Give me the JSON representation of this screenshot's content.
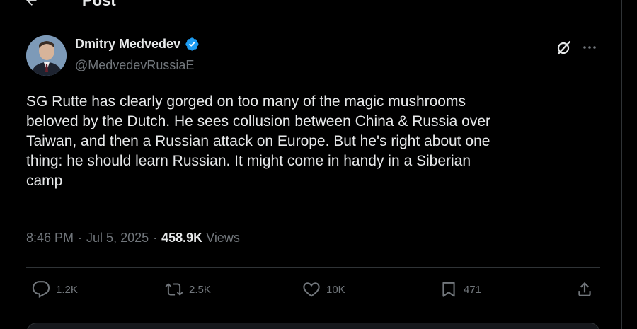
{
  "header": {
    "title": "Post",
    "back_icon": "arrow-left-icon"
  },
  "author": {
    "name": "Dmitry Medvedev",
    "handle": "@MedvedevRussiaE",
    "verified_icon": "verified-badge-icon",
    "avatar": "avatar"
  },
  "top_actions": {
    "grok_icon": "grok-icon",
    "more_icon": "more-icon"
  },
  "tweet": {
    "text": "SG Rutte has clearly gorged on too many of the magic mushrooms\nbeloved by the Dutch. He sees collusion between China & Russia over\nTaiwan, and then a Russian attack on Europe. But he's right about one\nthing: he should learn Russian. It might come in handy in a Siberian\ncamp"
  },
  "meta": {
    "time": "8:46 PM",
    "separator": "·",
    "date": "Jul 5, 2025",
    "views_count": "458.9K",
    "views_label": "Views"
  },
  "actions": {
    "replies": "1.2K",
    "reposts": "2.5K",
    "likes": "10K",
    "bookmarks": "471"
  },
  "colors": {
    "background": "#000000",
    "text_primary": "#e7e9ea",
    "text_secondary": "#71767b",
    "divider": "#2f3336",
    "verified": "#1d9bf0"
  }
}
